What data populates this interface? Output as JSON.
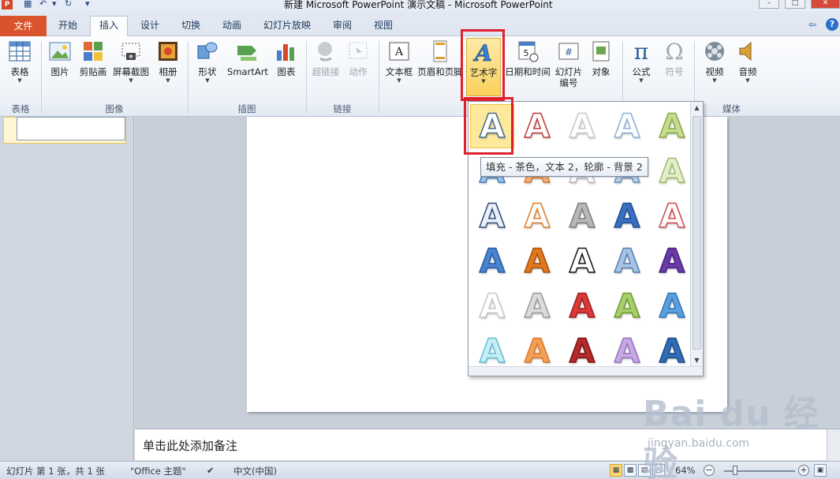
{
  "window": {
    "title": "新建 Microsoft PowerPoint 演示文稿 - Microsoft PowerPoint",
    "logo": "P"
  },
  "tabs": [
    {
      "label": "文件"
    },
    {
      "label": "开始"
    },
    {
      "label": "插入"
    },
    {
      "label": "设计"
    },
    {
      "label": "切换"
    },
    {
      "label": "动画"
    },
    {
      "label": "幻灯片放映"
    },
    {
      "label": "审阅"
    },
    {
      "label": "视图"
    }
  ],
  "ribbon": {
    "buttons": [
      {
        "label": "表格",
        "icon": "table-icon"
      },
      {
        "label": "图片",
        "icon": "picture-icon"
      },
      {
        "label": "剪贴画",
        "icon": "clipart-icon"
      },
      {
        "label": "屏幕截图",
        "icon": "screenshot-icon"
      },
      {
        "label": "相册",
        "icon": "photo-album-icon"
      },
      {
        "label": "形状",
        "icon": "shapes-icon"
      },
      {
        "label": "SmartArt",
        "icon": "smartart-icon"
      },
      {
        "label": "图表",
        "icon": "chart-icon"
      },
      {
        "label": "超链接",
        "icon": "hyperlink-icon"
      },
      {
        "label": "动作",
        "icon": "action-icon"
      },
      {
        "label": "文本框",
        "icon": "textbox-icon"
      },
      {
        "label": "页眉和页脚",
        "icon": "header-footer-icon"
      },
      {
        "label": "艺术字",
        "icon": "wordart-icon"
      },
      {
        "label": "日期和时间",
        "icon": "date-time-icon"
      },
      {
        "label": "幻灯片",
        "label2": "编号",
        "icon": "slide-number-icon"
      },
      {
        "label": "对象",
        "icon": "object-icon"
      },
      {
        "label": "公式",
        "icon": "equation-icon"
      },
      {
        "label": "符号",
        "icon": "symbol-icon"
      },
      {
        "label": "视频",
        "icon": "video-icon"
      },
      {
        "label": "音频",
        "icon": "audio-icon"
      }
    ],
    "groups": [
      {
        "label": "表格"
      },
      {
        "label": "图像"
      },
      {
        "label": "插图"
      },
      {
        "label": "链接"
      },
      {
        "label": "媒体"
      }
    ]
  },
  "gallery": {
    "tooltip": "填充 - 茶色，文本 2，轮廓 - 背景 2",
    "glyph": "A",
    "selected_index": 0,
    "styles": [
      {
        "fill": "#ffffff",
        "stroke": "#4a6d8c"
      },
      {
        "fill": "#ffffff",
        "stroke": "#c0393b"
      },
      {
        "fill": "#ffffff",
        "stroke": "#c8c8c8"
      },
      {
        "fill": "#ffffff",
        "stroke": "#8fb2d6"
      },
      {
        "fill": "#c7dc93",
        "stroke": "#8aaa3d"
      },
      {
        "fill": "#9fc2e7",
        "stroke": "#4a7db8"
      },
      {
        "fill": "#f4b183",
        "stroke": "#d97a2b"
      },
      {
        "fill": "#ffffff",
        "stroke": "#bbbbbb"
      },
      {
        "fill": "#b6cfe8",
        "stroke": "#6f93bf"
      },
      {
        "fill": "#e3efcc",
        "stroke": "#9fbd6a"
      },
      {
        "fill": "#eaf1fa",
        "stroke": "#2f4e78"
      },
      {
        "fill": "#ffffff",
        "stroke": "#e07d2a"
      },
      {
        "fill": "#b8b8b8",
        "stroke": "#7d7d7d"
      },
      {
        "fill": "#3a70c0",
        "stroke": "#1e4e96"
      },
      {
        "fill": "#ffffff",
        "stroke": "#d24649"
      },
      {
        "fill": "#4a83cf",
        "stroke": "#2a5ca4"
      },
      {
        "fill": "#e0781e",
        "stroke": "#a8520c"
      },
      {
        "fill": "#ffffff",
        "stroke": "#111111"
      },
      {
        "fill": "#a6c4e6",
        "stroke": "#587fae"
      },
      {
        "fill": "#6a3aa6",
        "stroke": "#4a1f86"
      },
      {
        "fill": "#ffffff",
        "stroke": "#c6c6c6"
      },
      {
        "fill": "#dcdcdc",
        "stroke": "#9a9a9a"
      },
      {
        "fill": "#d93a3a",
        "stroke": "#a11c1c"
      },
      {
        "fill": "#a6cf6a",
        "stroke": "#6e9a2e"
      },
      {
        "fill": "#5ba0de",
        "stroke": "#2f73b8"
      },
      {
        "fill": "#c8eef6",
        "stroke": "#61bfd6"
      },
      {
        "fill": "#f2a055",
        "stroke": "#d9782a"
      },
      {
        "fill": "#b52a2a",
        "stroke": "#7a1414"
      },
      {
        "fill": "#c9a9e2",
        "stroke": "#9272c0"
      },
      {
        "fill": "#2f6db6",
        "stroke": "#1a4a86"
      }
    ]
  },
  "notes": {
    "placeholder": "单击此处添加备注"
  },
  "status": {
    "slide_info": "幻灯片 第 1 张，共 1 张",
    "theme": "\"Office 主题\"",
    "language": "中文(中国)",
    "zoom": "64%",
    "zoom_fraction": 0.16
  },
  "watermark": {
    "brand": "Bai du 经验",
    "url": "jingyan.baidu.com"
  },
  "colors": {
    "file_tab": "#d9532c",
    "highlight": "#e0202e",
    "selected_style_bg": "#fde89c"
  }
}
